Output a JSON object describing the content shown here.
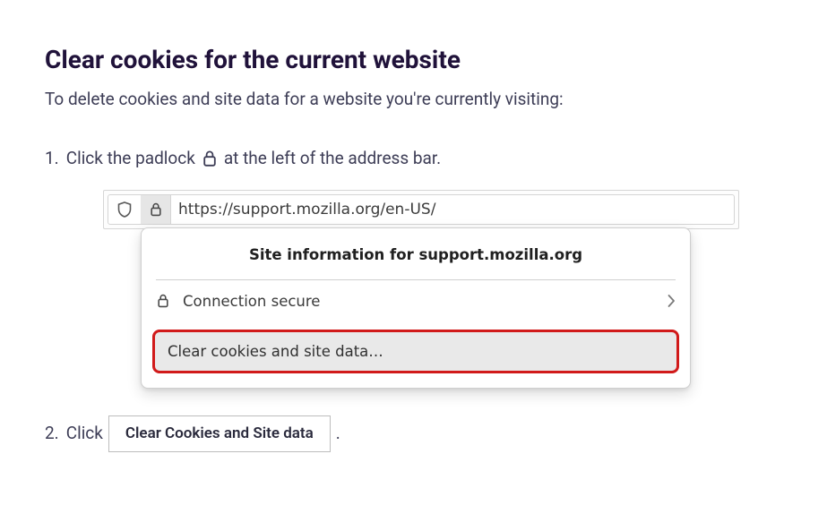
{
  "heading": "Clear cookies for the current website",
  "intro": "To delete cookies and site data for a website you're currently visiting:",
  "step1": {
    "num": "1.",
    "pre": "Click the padlock",
    "post": "at the left of the address bar."
  },
  "addressbar": {
    "url": "https://support.mozilla.org/en-US/"
  },
  "popover": {
    "title": "Site information for support.mozilla.org",
    "connection": "Connection secure",
    "clear": "Clear cookies and site data…"
  },
  "step2": {
    "num": "2.",
    "pre": "Click",
    "button": "Clear Cookies and Site data",
    "post": "."
  }
}
